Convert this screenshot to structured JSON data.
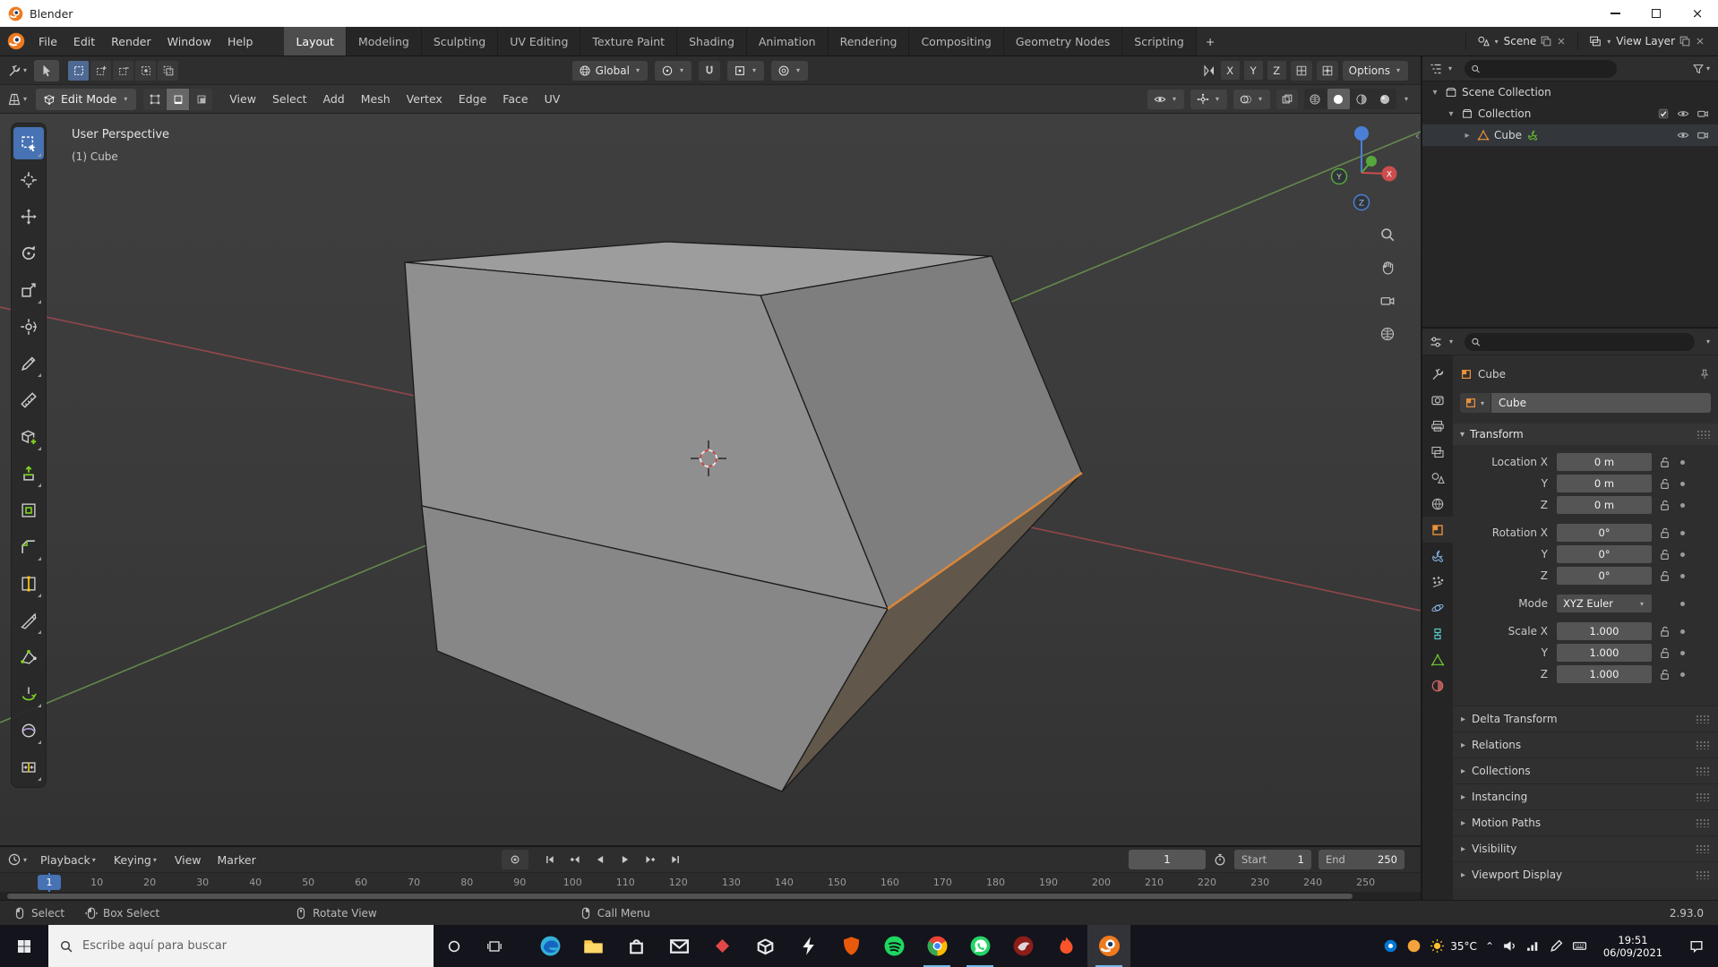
{
  "titlebar": {
    "title": "Blender"
  },
  "topbar": {
    "menus": [
      "File",
      "Edit",
      "Render",
      "Window",
      "Help"
    ],
    "tabs": [
      "Layout",
      "Modeling",
      "Sculpting",
      "UV Editing",
      "Texture Paint",
      "Shading",
      "Animation",
      "Rendering",
      "Compositing",
      "Geometry Nodes",
      "Scripting"
    ],
    "active_tab": "Layout",
    "add_tab": "+",
    "scene": {
      "label": "Scene"
    },
    "view_layer": {
      "label": "View Layer"
    }
  },
  "tool_settings": {
    "orientation": "Global",
    "mirror_axes": [
      "X",
      "Y",
      "Z"
    ],
    "options": "Options"
  },
  "viewport": {
    "header": {
      "mode": "Edit Mode",
      "menus": [
        "View",
        "Select",
        "Add",
        "Mesh",
        "Vertex",
        "Edge",
        "Face",
        "UV"
      ]
    },
    "overlay": {
      "line1": "User Perspective",
      "line2": "(1) Cube"
    },
    "gizmo": {
      "x": "X",
      "y": "Y",
      "z": "Z"
    },
    "tools": [
      {
        "name": "select-box",
        "active": true,
        "sub": true
      },
      {
        "name": "cursor"
      },
      {
        "name": "move"
      },
      {
        "name": "rotate"
      },
      {
        "name": "scale",
        "sub": true
      },
      {
        "name": "transform"
      },
      {
        "name": "annotate",
        "sub": true
      },
      {
        "name": "measure"
      },
      {
        "name": "add-cube",
        "sub": true
      },
      {
        "name": "extrude-region",
        "sub": true
      },
      {
        "name": "inset-faces"
      },
      {
        "name": "bevel",
        "sub": true
      },
      {
        "name": "loop-cut",
        "sub": true
      },
      {
        "name": "knife",
        "sub": true
      },
      {
        "name": "poly-build"
      },
      {
        "name": "spin",
        "sub": true
      },
      {
        "name": "smooth",
        "sub": true
      },
      {
        "name": "edge-slide",
        "sub": true
      }
    ]
  },
  "outliner": {
    "items": [
      {
        "label": "Scene Collection",
        "icon": "scene-collection",
        "depth": 0,
        "arrow": "▾"
      },
      {
        "label": "Collection",
        "icon": "collection",
        "depth": 1,
        "arrow": "▾",
        "checkbox": true,
        "eye": true,
        "camera": true
      },
      {
        "label": "Cube",
        "icon": "mesh",
        "depth": 2,
        "arrow": "▸",
        "modifier": true,
        "eye": true,
        "camera": true,
        "selected": true
      }
    ]
  },
  "properties": {
    "breadcrumb": "Cube",
    "name_field": "Cube",
    "tabs": [
      {
        "name": "tool"
      },
      {
        "name": "render"
      },
      {
        "name": "output"
      },
      {
        "name": "view-layer"
      },
      {
        "name": "scene"
      },
      {
        "name": "world"
      },
      {
        "name": "object",
        "active": true
      },
      {
        "name": "modifiers"
      },
      {
        "name": "particles"
      },
      {
        "name": "physics"
      },
      {
        "name": "constraints"
      },
      {
        "name": "data"
      },
      {
        "name": "material"
      }
    ],
    "transform": {
      "title": "Transform",
      "rows": [
        {
          "label": "Location X",
          "value": "0 m",
          "lock": true
        },
        {
          "label": "Y",
          "value": "0 m",
          "lock": true
        },
        {
          "label": "Z",
          "value": "0 m",
          "lock": true
        },
        {
          "label": "Rotation X",
          "value": "0°",
          "lock": true
        },
        {
          "label": "Y",
          "value": "0°",
          "lock": true
        },
        {
          "label": "Z",
          "value": "0°",
          "lock": true
        },
        {
          "label": "Mode",
          "value": "XYZ Euler",
          "lock": false,
          "type": "dropdown"
        },
        {
          "label": "Scale X",
          "value": "1.000",
          "lock": true
        },
        {
          "label": "Y",
          "value": "1.000",
          "lock": true
        },
        {
          "label": "Z",
          "value": "1.000",
          "lock": true
        }
      ]
    },
    "sections": [
      "Delta Transform",
      "Relations",
      "Collections",
      "Instancing",
      "Motion Paths",
      "Visibility",
      "Viewport Display"
    ]
  },
  "timeline": {
    "menus": [
      {
        "label": "Playback",
        "caret": true
      },
      {
        "label": "Keying",
        "caret": true
      },
      {
        "label": "View"
      },
      {
        "label": "Marker"
      }
    ],
    "current_frame": "1",
    "frame_field": "1",
    "start": {
      "label": "Start",
      "value": "1"
    },
    "end": {
      "label": "End",
      "value": "250"
    },
    "ticks": [
      10,
      20,
      30,
      40,
      50,
      60,
      70,
      80,
      90,
      100,
      110,
      120,
      130,
      140,
      150,
      160,
      170,
      180,
      190,
      200,
      210,
      220,
      230,
      240,
      250
    ]
  },
  "statusbar": {
    "groups": [
      {
        "icon": "mouse-left",
        "label": "Select"
      },
      {
        "icon": "mouse-drag",
        "label": "Box Select"
      },
      {
        "icon": "mouse-middle",
        "label": "Rotate View"
      },
      {
        "icon": "mouse-right",
        "label": "Call Menu"
      }
    ],
    "version": "2.93.0"
  },
  "taskbar": {
    "search_placeholder": "Escribe aquí para buscar",
    "apps": [
      {
        "name": "edge"
      },
      {
        "name": "explorer"
      },
      {
        "name": "store"
      },
      {
        "name": "mail"
      },
      {
        "name": "diamond-app"
      },
      {
        "name": "box-app"
      },
      {
        "name": "bolt-app"
      },
      {
        "name": "shield-app"
      },
      {
        "name": "spotify"
      },
      {
        "name": "chrome",
        "running": true
      },
      {
        "name": "whatsapp",
        "running": true
      },
      {
        "name": "red-bird-app"
      },
      {
        "name": "flame-app"
      },
      {
        "name": "blender",
        "running": true,
        "active": true
      }
    ],
    "weather": "35°C",
    "time": "19:51",
    "date": "06/09/2021"
  },
  "colors": {
    "accent_blue": "#4772b3",
    "selected_edge_orange": "#d8863b",
    "object_orange": "#e8913a",
    "mesh_data_green": "#6abe30",
    "axis_red": "#a84a50",
    "axis_green": "#6e9c52"
  }
}
